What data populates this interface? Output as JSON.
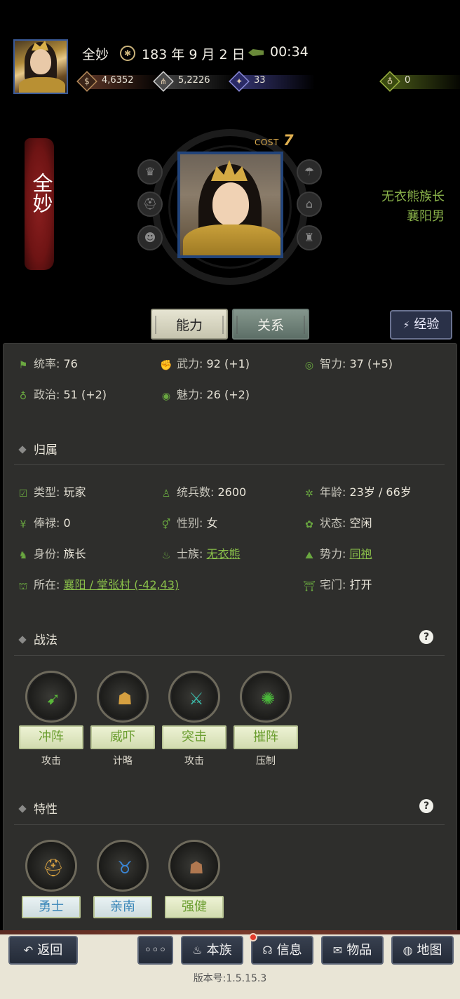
{
  "header": {
    "name": "全妙",
    "date": "183 年 9 月 2 日",
    "time": "00:34",
    "resources": {
      "money": "4,6352",
      "food": "5,2226",
      "troops": "33",
      "gold": "0"
    }
  },
  "character": {
    "banner_name": "全妙",
    "cost_label": "COST",
    "cost_value": "7",
    "title_1": "无衣熊族长",
    "title_2": "襄阳男"
  },
  "tabs": {
    "ability": "能力",
    "relation": "关系",
    "experience": "经验"
  },
  "stats": {
    "command": {
      "label": "统率:",
      "value": "76"
    },
    "force": {
      "label": "武力:",
      "value": "92 (+1)"
    },
    "intelligence": {
      "label": "智力:",
      "value": "37 (+5)"
    },
    "politics": {
      "label": "政治:",
      "value": "51 (+2)"
    },
    "charm": {
      "label": "魅力:",
      "value": "26 (+2)"
    }
  },
  "belong": {
    "title": "归属",
    "type": {
      "label": "类型:",
      "value": "玩家"
    },
    "soldiers": {
      "label": "统兵数:",
      "value": "2600"
    },
    "age": {
      "label": "年龄:",
      "value": "23岁 / 66岁"
    },
    "salary": {
      "label": "俸禄:",
      "value": "0"
    },
    "gender": {
      "label": "性别:",
      "value": "女"
    },
    "status": {
      "label": "状态:",
      "value": "空闲"
    },
    "identity": {
      "label": "身份:",
      "value": "族长"
    },
    "clan": {
      "label": "士族:",
      "value": "无衣熊"
    },
    "faction": {
      "label": "势力:",
      "value": "同袍"
    },
    "location": {
      "label": "所在:",
      "value": "襄阳 / 堂张村 (-42,43)"
    },
    "gate": {
      "label": "宅门:",
      "value": "打开"
    }
  },
  "tactics": {
    "title": "战法",
    "items": [
      {
        "name": "冲阵",
        "kind": "攻击"
      },
      {
        "name": "威吓",
        "kind": "计略"
      },
      {
        "name": "突击",
        "kind": "攻击"
      },
      {
        "name": "摧阵",
        "kind": "压制"
      }
    ]
  },
  "traits": {
    "title": "特性",
    "items": [
      {
        "name": "勇士"
      },
      {
        "name": "亲南"
      },
      {
        "name": "强健"
      }
    ]
  },
  "bottom_nav": {
    "back": "返回",
    "more": "◦◦◦",
    "clan": "本族",
    "info": "信息",
    "items": "物品",
    "map": "地图",
    "version": "版本号:1.5.15.3"
  }
}
